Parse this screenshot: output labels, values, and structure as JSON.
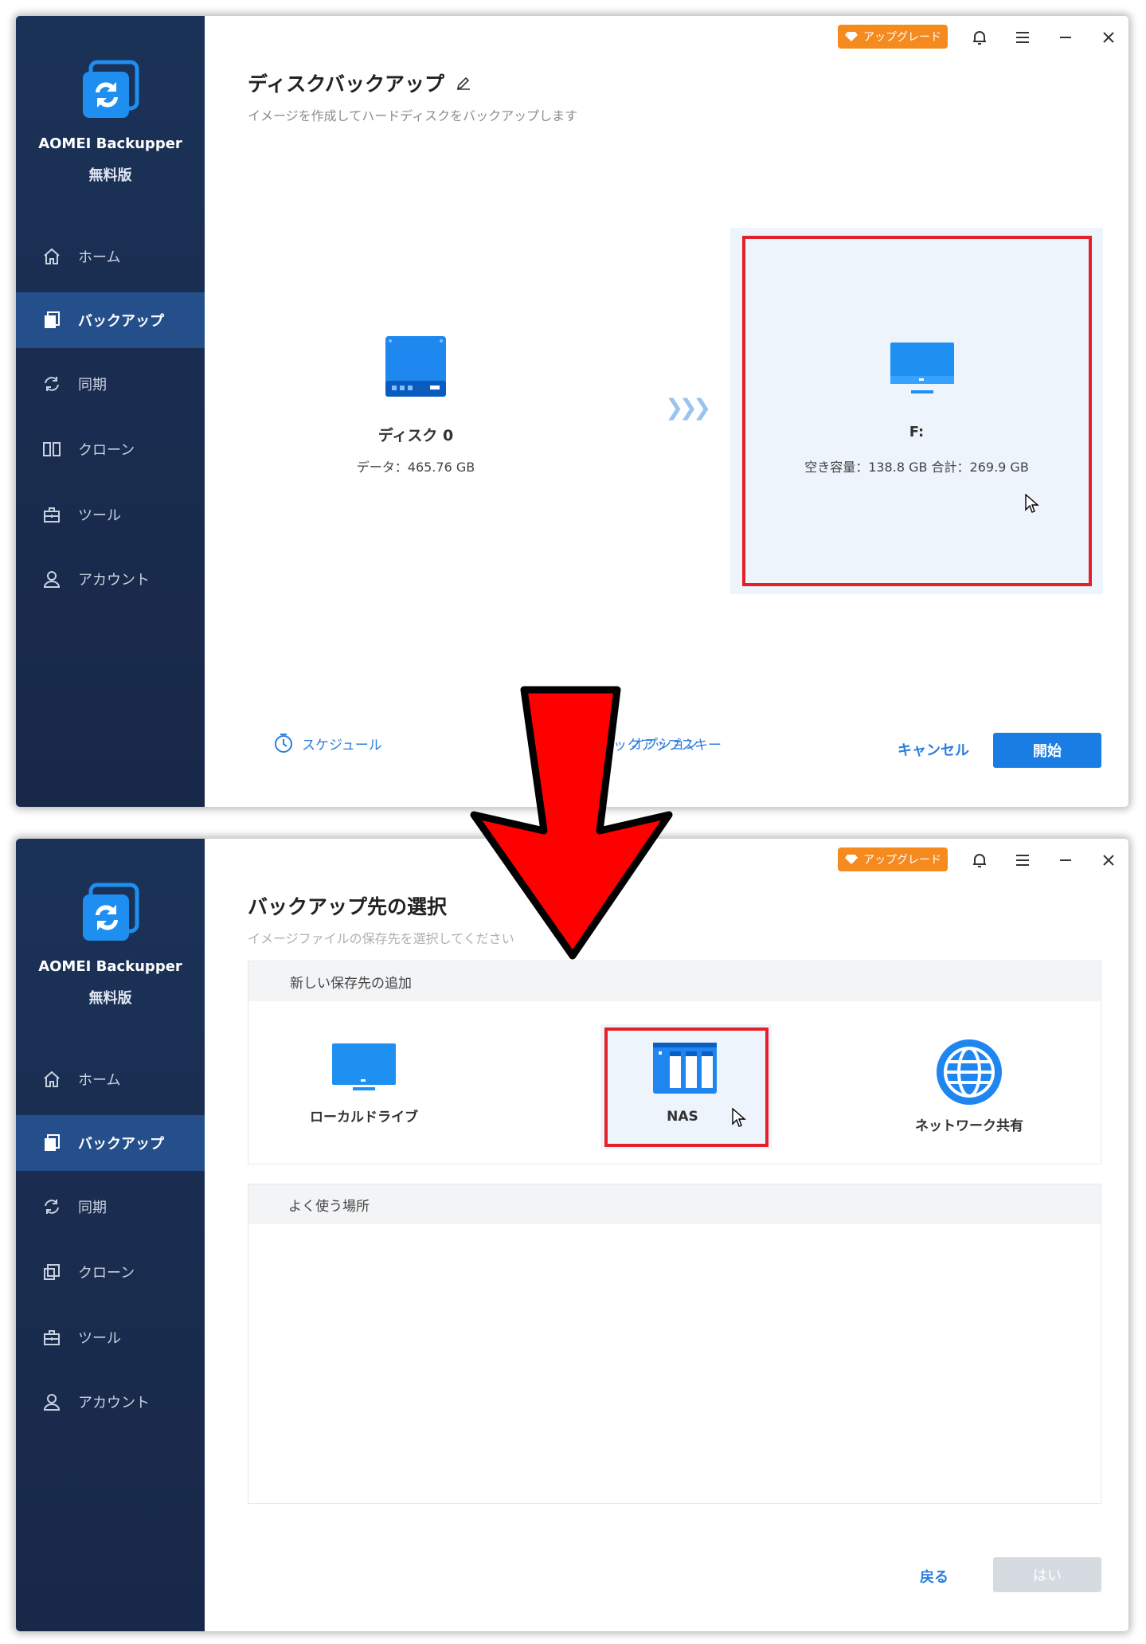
{
  "brand": {
    "name": "AOMEI Backupper",
    "edition": "無料版"
  },
  "toolbar": {
    "upgrade_label": "アップグレード"
  },
  "nav_top": [
    {
      "label": "ホーム",
      "icon": "home-icon"
    },
    {
      "label": "バックアップ",
      "icon": "backup-icon",
      "active": true
    },
    {
      "label": "同期",
      "icon": "sync-icon"
    },
    {
      "label": "クローン",
      "icon": "clone-icon"
    },
    {
      "label": "ツール",
      "icon": "tools-icon"
    },
    {
      "label": "アカウント",
      "icon": "account-icon"
    }
  ],
  "window1": {
    "title": "ディスクバックアップ",
    "subtitle": "イメージを作成してハードディスクをバックアップします",
    "source": {
      "name": "ディスク 0",
      "data": "データ：465.76 GB"
    },
    "destination": {
      "name": "F:",
      "info": "空き容量：138.8 GB 合計：269.9 GB"
    },
    "bottom": {
      "schedule": "スケジュール",
      "scheme": "バックアップスキー",
      "options": "オプション",
      "cancel": "キャンセル",
      "start": "開始"
    }
  },
  "window2": {
    "title": "バックアップ先の選択",
    "subtitle": "イメージファイルの保存先を選択してください",
    "new_section": "新しい保存先の追加",
    "options": [
      {
        "label": "ローカルドライブ"
      },
      {
        "label": "NAS"
      },
      {
        "label": "ネットワーク共有"
      }
    ],
    "frequent_section": "よく使う場所",
    "back": "戻る",
    "yes": "はい"
  },
  "colors": {
    "accent": "#1a7de3",
    "sidebar": "#1b3258",
    "highlight": "#e4202b",
    "upgrade": "#f58a1f"
  }
}
